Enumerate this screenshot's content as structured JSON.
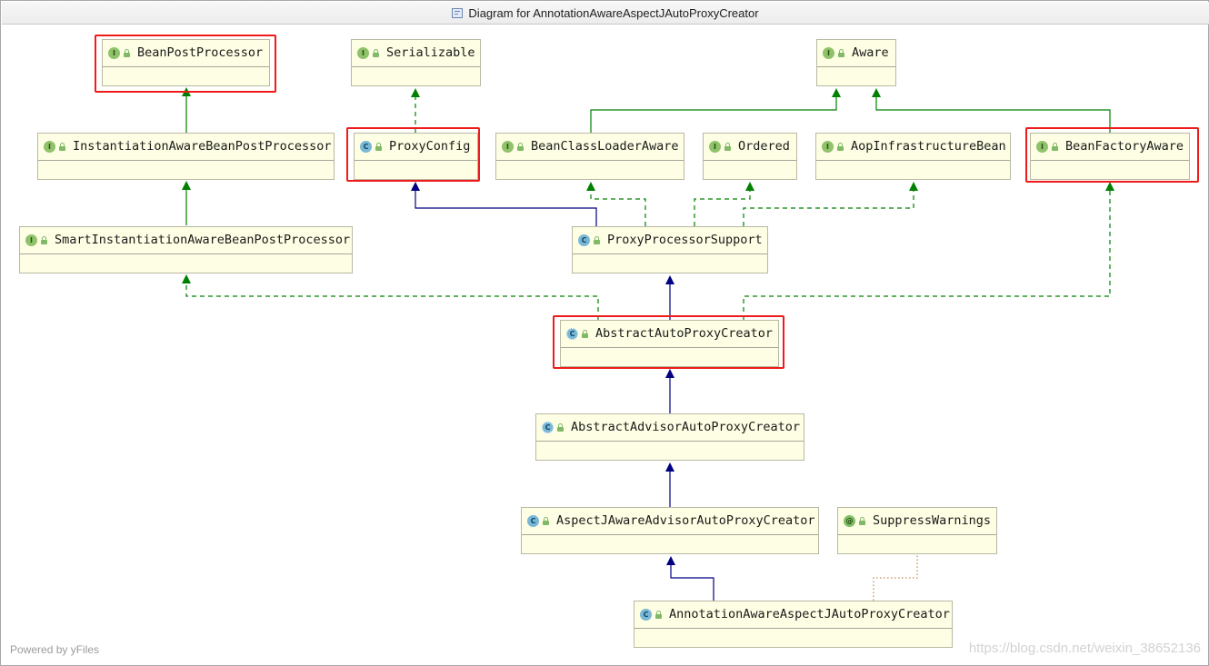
{
  "window": {
    "title": "Diagram for AnnotationAwareAspectJAutoProxyCreator"
  },
  "legend_colors": {
    "extends": "#000080",
    "implements": "#008000",
    "annotated": "#c08a4a",
    "highlight": "#ee1b1b",
    "node_fill": "#fefee4"
  },
  "nodes": [
    {
      "id": "bpp",
      "name": "BeanPostProcessor",
      "kind": "interface",
      "icon": "interface-icon",
      "highlighted": true
    },
    {
      "id": "ser",
      "name": "Serializable",
      "kind": "interface",
      "icon": "interface-icon",
      "highlighted": false
    },
    {
      "id": "aware",
      "name": "Aware",
      "kind": "interface",
      "icon": "interface-icon",
      "highlighted": false
    },
    {
      "id": "iabpp",
      "name": "InstantiationAwareBeanPostProcessor",
      "kind": "interface",
      "icon": "interface-icon",
      "highlighted": false
    },
    {
      "id": "pc",
      "name": "ProxyConfig",
      "kind": "class",
      "icon": "class-icon",
      "highlighted": true
    },
    {
      "id": "bcla",
      "name": "BeanClassLoaderAware",
      "kind": "interface",
      "icon": "interface-icon",
      "highlighted": false
    },
    {
      "id": "ord",
      "name": "Ordered",
      "kind": "interface",
      "icon": "interface-icon",
      "highlighted": false
    },
    {
      "id": "aib",
      "name": "AopInfrastructureBean",
      "kind": "interface",
      "icon": "interface-icon",
      "highlighted": false
    },
    {
      "id": "bfa",
      "name": "BeanFactoryAware",
      "kind": "interface",
      "icon": "interface-icon",
      "highlighted": true
    },
    {
      "id": "siabpp",
      "name": "SmartInstantiationAwareBeanPostProcessor",
      "kind": "interface",
      "icon": "interface-icon",
      "highlighted": false
    },
    {
      "id": "pps",
      "name": "ProxyProcessorSupport",
      "kind": "class",
      "icon": "class-icon",
      "highlighted": false
    },
    {
      "id": "aapc",
      "name": "AbstractAutoProxyCreator",
      "kind": "abstract",
      "icon": "abstract-class-icon",
      "highlighted": true
    },
    {
      "id": "aaapc",
      "name": "AbstractAdvisorAutoProxyCreator",
      "kind": "abstract",
      "icon": "abstract-class-icon",
      "highlighted": false
    },
    {
      "id": "ajaapc",
      "name": "AspectJAwareAdvisorAutoProxyCreator",
      "kind": "class",
      "icon": "class-icon",
      "highlighted": false
    },
    {
      "id": "sw",
      "name": "SuppressWarnings",
      "kind": "annotation",
      "icon": "annotation-icon",
      "highlighted": false
    },
    {
      "id": "aaajapc",
      "name": "AnnotationAwareAspectJAutoProxyCreator",
      "kind": "class",
      "icon": "class-icon",
      "highlighted": false
    }
  ],
  "edges": [
    {
      "from": "iabpp",
      "to": "bpp",
      "type": "extends-interface"
    },
    {
      "from": "siabpp",
      "to": "iabpp",
      "type": "extends-interface"
    },
    {
      "from": "pc",
      "to": "ser",
      "type": "implements"
    },
    {
      "from": "bcla",
      "to": "aware",
      "type": "extends-interface"
    },
    {
      "from": "bfa",
      "to": "aware",
      "type": "extends-interface"
    },
    {
      "from": "pps",
      "to": "pc",
      "type": "extends"
    },
    {
      "from": "pps",
      "to": "bcla",
      "type": "implements"
    },
    {
      "from": "pps",
      "to": "ord",
      "type": "implements"
    },
    {
      "from": "pps",
      "to": "aib",
      "type": "implements"
    },
    {
      "from": "aapc",
      "to": "pps",
      "type": "extends"
    },
    {
      "from": "aapc",
      "to": "siabpp",
      "type": "implements"
    },
    {
      "from": "aapc",
      "to": "bfa",
      "type": "implements"
    },
    {
      "from": "aaapc",
      "to": "aapc",
      "type": "extends"
    },
    {
      "from": "ajaapc",
      "to": "aaapc",
      "type": "extends"
    },
    {
      "from": "aaajapc",
      "to": "ajaapc",
      "type": "extends"
    },
    {
      "from": "aaajapc",
      "to": "sw",
      "type": "annotated"
    }
  ],
  "footer": {
    "powered_by": "Powered by yFiles"
  },
  "watermark": {
    "text": "https://blog.csdn.net/weixin_38652136"
  }
}
